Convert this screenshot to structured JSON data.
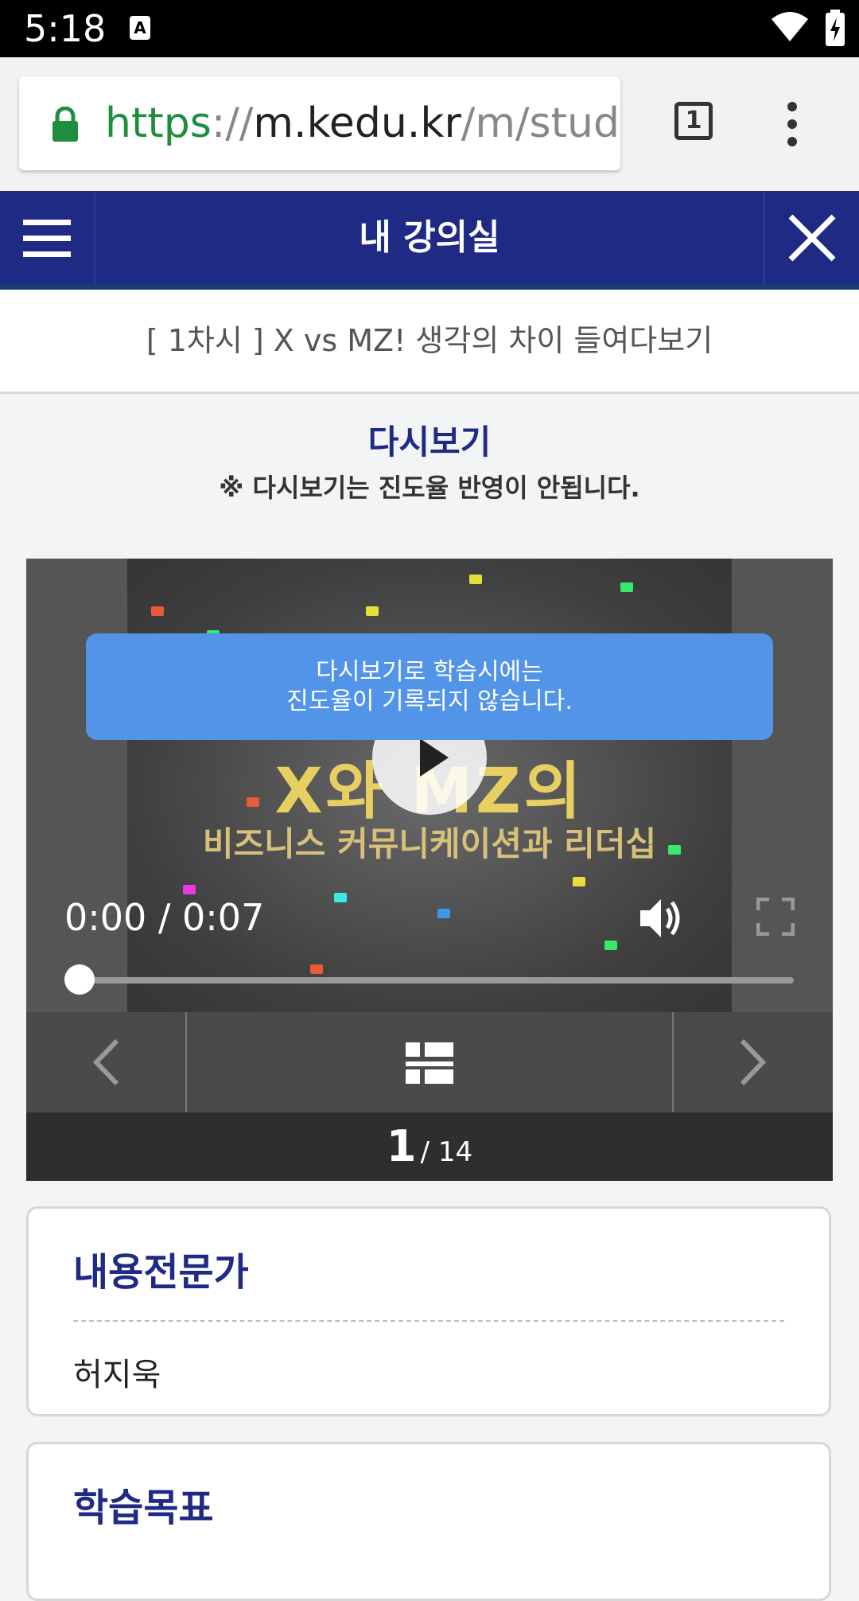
{
  "status_bar": {
    "time": "5:18",
    "notification_icon_label": "A"
  },
  "browser": {
    "url_scheme": "https",
    "url_separator": "://",
    "url_host": "m.kedu.kr",
    "url_path": "/m/study",
    "tab_count": "1"
  },
  "header": {
    "title": "내 강의실"
  },
  "lesson": {
    "title": "[ 1차시 ] X vs MZ! 생각의 차이 들여다보기"
  },
  "review": {
    "title": "다시보기",
    "note": "※ 다시보기는 진도율 반영이 안됩니다."
  },
  "player": {
    "video_title_text": "X와 MZ의",
    "video_subtitle_text": "비즈니스 커뮤니케이션과 리더십",
    "notice_line1": "다시보기로 학습시에는",
    "notice_line2": "진도율이 기록되지 않습니다.",
    "time_display": "0:00 / 0:07",
    "progress_fraction": 0.02,
    "page_current": "1",
    "page_total": "/ 14"
  },
  "cards": [
    {
      "heading": "내용전문가",
      "body": "허지욱"
    },
    {
      "heading": "학습목표"
    }
  ],
  "colors": {
    "brand_navy": "#1f2a85",
    "notice_blue": "#5294e8",
    "url_green": "#1e8e3e"
  }
}
